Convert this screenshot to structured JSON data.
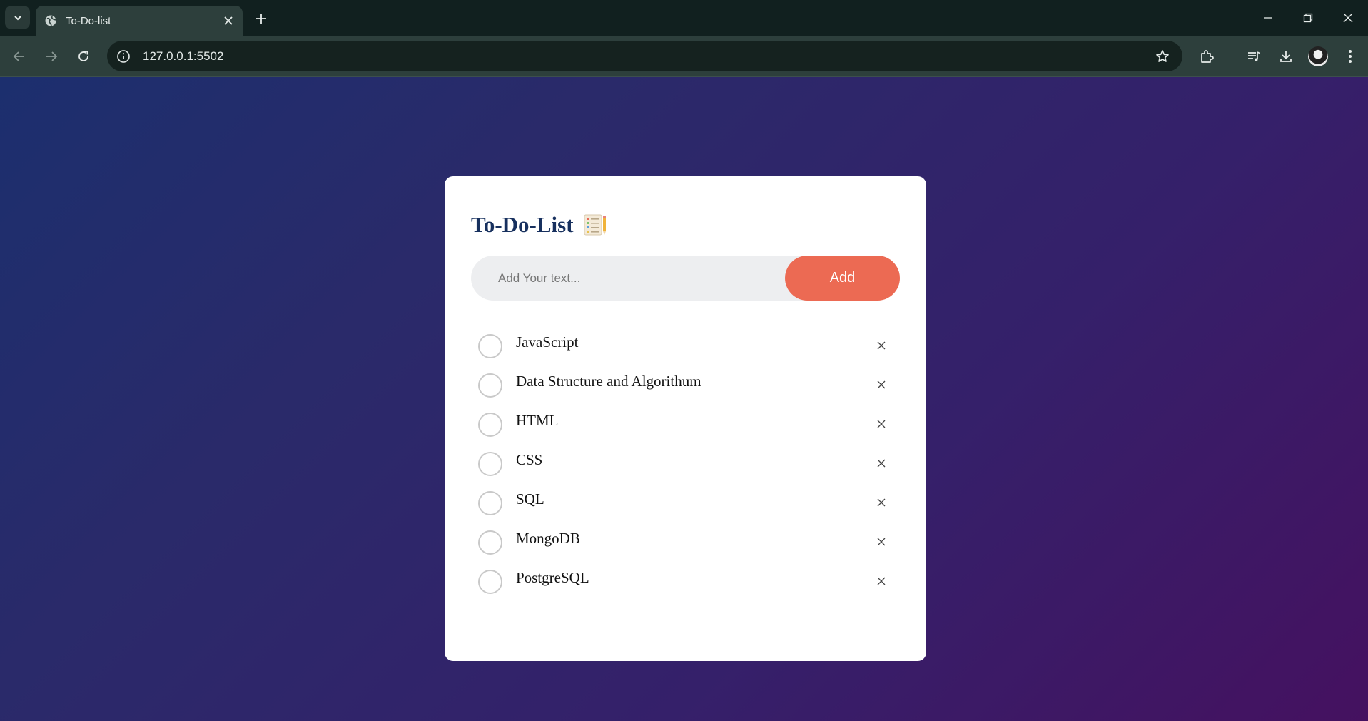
{
  "browser": {
    "tab_title": "To-Do-list",
    "url": "127.0.0.1:5502"
  },
  "app": {
    "heading": "To-Do-List",
    "heading_icon": "notebook-icon",
    "input": {
      "placeholder": "Add Your text...",
      "value": ""
    },
    "add_label": "Add",
    "accent_color": "#ec6a53",
    "heading_color": "#17305e",
    "todos": [
      {
        "text": "JavaScript",
        "done": false
      },
      {
        "text": "Data Structure and Algorithum",
        "done": false
      },
      {
        "text": "HTML",
        "done": false
      },
      {
        "text": "CSS",
        "done": false
      },
      {
        "text": "SQL",
        "done": false
      },
      {
        "text": "MongoDB",
        "done": false
      },
      {
        "text": "PostgreSQL",
        "done": false
      }
    ]
  }
}
